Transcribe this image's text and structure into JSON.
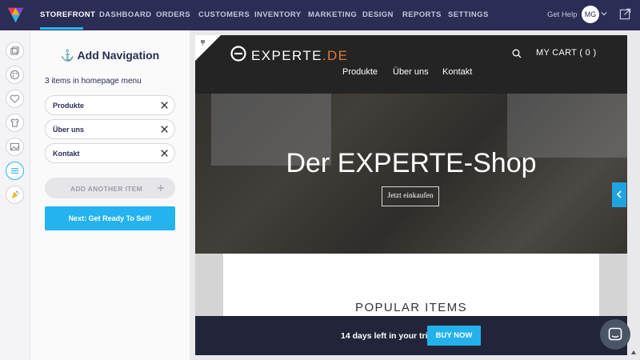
{
  "topnav": {
    "items": [
      {
        "label": "STOREFRONT",
        "active": true
      },
      {
        "label": "DASHBOARD"
      },
      {
        "label": "ORDERS"
      },
      {
        "label": "CUSTOMERS"
      },
      {
        "label": "INVENTORY"
      },
      {
        "label": "MARKETING"
      },
      {
        "label": "DESIGN"
      },
      {
        "label": "REPORTS"
      },
      {
        "label": "SETTINGS"
      }
    ],
    "get_help": "Get Help",
    "avatar_initials": "MG"
  },
  "rail": {
    "icons": [
      "pages-icon",
      "palette-icon",
      "heart-icon",
      "tshirt-icon",
      "image-icon",
      "menu-icon",
      "party-icon"
    ],
    "active": "menu-icon"
  },
  "panel": {
    "title": "⚓ Add Navigation",
    "subtitle": "3 items in homepage menu",
    "items": [
      {
        "label": "Produkte"
      },
      {
        "label": "Über uns"
      },
      {
        "label": "Kontakt"
      }
    ],
    "add_label": "ADD ANOTHER ITEM",
    "next_label": "Next: Get Ready To Sell!"
  },
  "site": {
    "brand": "EXPERTE",
    "brand_tld": ".DE",
    "cart": "MY CART ( 0 )",
    "menu": [
      "Produkte",
      "Über uns",
      "Kontakt"
    ],
    "hero_title": "Der EXPERTE-Shop",
    "hero_button": "Jetzt einkaufen",
    "section_title": "POPULAR ITEMS"
  },
  "trial": {
    "text": "14 days left in your trial",
    "button": "BUY NOW"
  },
  "colors": {
    "topbar": "#2b2d55",
    "accent": "#24b3ee",
    "brand_tld": "#e07a3c"
  }
}
